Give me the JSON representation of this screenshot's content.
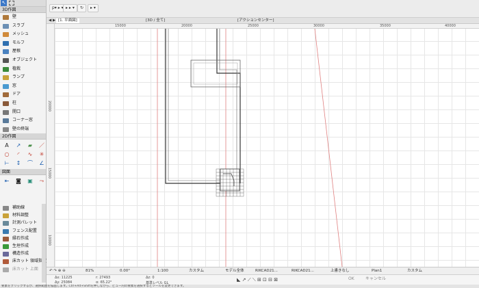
{
  "toolbar": {
    "btn1": "p▾ ▸ ▾",
    "btn2": "▸ ▸ ▾",
    "btn3": "↻",
    "btn4": "▸ ▾"
  },
  "left_panel": {
    "section_design": "3D作図",
    "tools": [
      "壁",
      "スラブ",
      "メッシュ",
      "モルフ",
      "屋根",
      "オブジェクト",
      "植栽",
      "ランプ",
      "窓",
      "ドア",
      "柱",
      "開口",
      "コーナー窓",
      "壁の終端"
    ],
    "section_2d": "2D作図",
    "section_doc": "図面",
    "nav_items": [
      "補助線",
      "材料調整",
      "計測パレット",
      "フェンス配置",
      "縁石作成",
      "生垣作成",
      "構造作成",
      "床カット 領域指定",
      "床カット 上面"
    ]
  },
  "view_tabs": {
    "plan": "[1. 平面図]",
    "3d": "[3D / 全て]",
    "action": "[アクションセンター]"
  },
  "rulers": {
    "top": [
      "15000",
      "20000",
      "25000",
      "30000",
      "35000",
      "40000"
    ],
    "left": [
      "20000",
      "15000",
      "10000"
    ]
  },
  "statusbar": {
    "zoom": "81%",
    "angle": "0.00°",
    "scale": "1:100",
    "custom1": "カスタム",
    "model": "モデル全体",
    "layer1": "RIKCAD21...",
    "layer2": "RIKCAD21...",
    "overwrite": "上書きなし",
    "plan": "Plan1",
    "custom2": "カスタム"
  },
  "infobar": {
    "ax": "Δx: 11225",
    "ay": "Δy: 25084",
    "r": "r: 27493",
    "a": "α: 65.22°",
    "az": "Δz: 0",
    "ref": "基準レベル GL",
    "ok": "OK",
    "cancel": "キャンセル"
  },
  "hint": "要素をクリックするか、選択範囲を描画します。Ctrl+Alt+Shiftを押しながら、ビュー内の要素を選択するとツールを変更できます。"
}
